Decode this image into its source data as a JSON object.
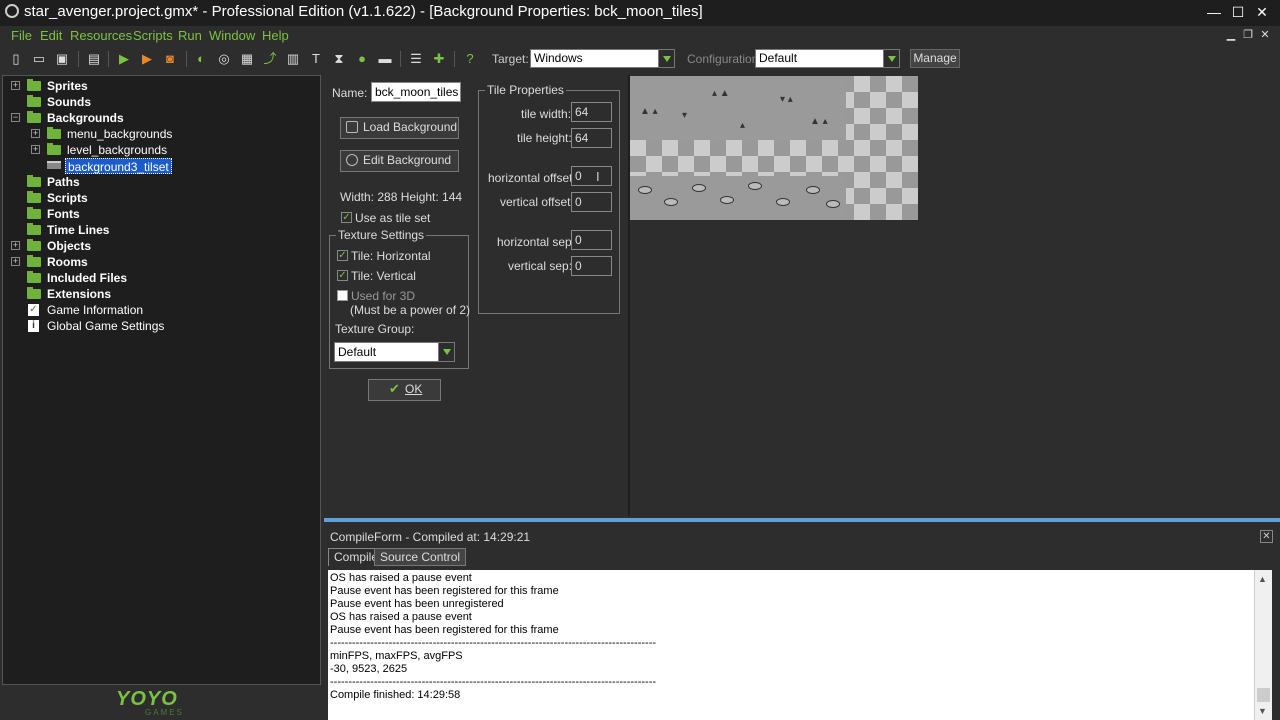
{
  "window": {
    "title": "star_avenger.project.gmx*  -  Professional Edition (v1.1.622) - [Background Properties: bck_moon_tiles]",
    "minimize": "—",
    "maximize": "☐",
    "close": "✕"
  },
  "menu": [
    "File",
    "Edit",
    "Resources",
    "Scripts",
    "Run",
    "Window",
    "Help"
  ],
  "mdi": {
    "minimize": "▁",
    "restore": "❐",
    "close": "✕"
  },
  "toolbar": {
    "target_label": "Target:",
    "target_value": "Windows",
    "configuration_label": "Configuration:",
    "configuration_value": "Default",
    "manage_label": "Manage"
  },
  "tree": {
    "sprites": "Sprites",
    "sounds": "Sounds",
    "backgrounds": "Backgrounds",
    "menu_backgrounds": "menu_backgrounds",
    "level_backgrounds": "level_backgrounds",
    "background3_tilset": "background3_tilset",
    "paths": "Paths",
    "scripts": "Scripts",
    "fonts": "Fonts",
    "time_lines": "Time Lines",
    "objects": "Objects",
    "rooms": "Rooms",
    "included_files": "Included Files",
    "extensions": "Extensions",
    "game_information": "Game Information",
    "global_game_settings": "Global Game Settings"
  },
  "logo": {
    "text": "YOYO",
    "sub": "GAMES"
  },
  "props": {
    "name_label": "Name:",
    "name_value": "bck_moon_tiles",
    "load_background": "Load Background",
    "edit_background": "Edit Background",
    "size": "Width: 288   Height: 144",
    "use_as_tile_set": "Use as tile set",
    "texture_settings": "Texture Settings",
    "tile_horizontal": "Tile: Horizontal",
    "tile_vertical": "Tile: Vertical",
    "used_for_3d": "Used for 3D",
    "power_of_2": "(Must be a power of 2)",
    "texture_group_label": "Texture Group:",
    "texture_group_value": "Default",
    "ok": "OK"
  },
  "tile_props": {
    "title": "Tile Properties",
    "tile_width_label": "tile width:",
    "tile_width": "64",
    "tile_height_label": "tile height:",
    "tile_height": "64",
    "horizontal_offset_label": "horizontal offset:",
    "horizontal_offset": "0",
    "vertical_offset_label": "vertical offset:",
    "vertical_offset": "0",
    "horizontal_sep_label": "horizontal sep:",
    "horizontal_sep": "0",
    "vertical_sep_label": "vertical sep:",
    "vertical_sep": "0"
  },
  "compile": {
    "title": "CompileForm - Compiled at: 14:29:21",
    "tab_compile": "Compile",
    "tab_source_control": "Source Control",
    "close": "✕",
    "lines": [
      "OS has raised a pause event",
      "Pause event has been registered for this frame",
      "Pause event has been unregistered",
      "OS has raised a pause event",
      "Pause event has been registered for this frame",
      "-----------------------------------------------------------------------------------------",
      "minFPS, maxFPS, avgFPS",
      "-30, 9523, 2625",
      "-----------------------------------------------------------------------------------------",
      "Compile finished: 14:29:58"
    ]
  },
  "colors": {
    "accent": "#7cc242",
    "selection": "#1c5cc9",
    "panel": "#2d2d2d"
  }
}
